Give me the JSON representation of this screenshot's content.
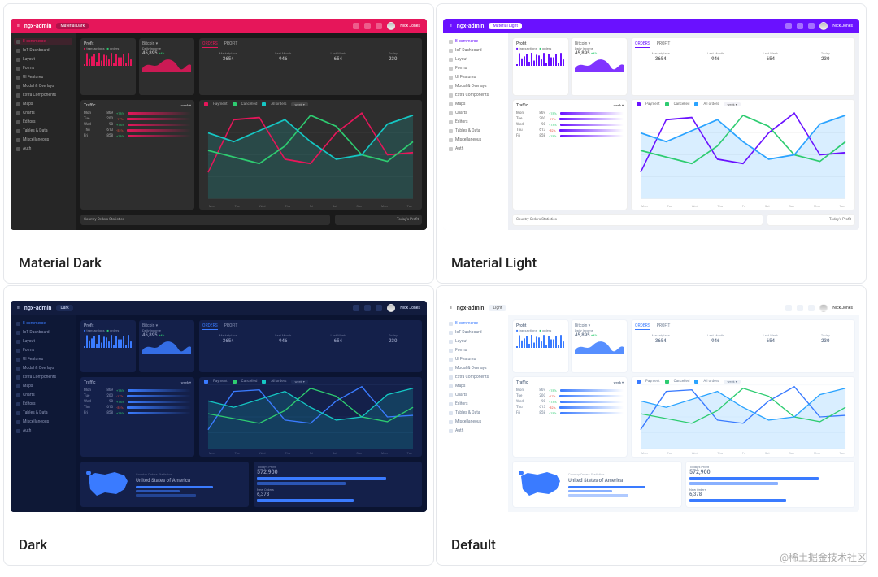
{
  "watermark": "@稀土掘金技术社区",
  "themes": [
    {
      "id": "material-dark",
      "cls": "t-md",
      "caption": "Material Dark",
      "pill": "Material Dark",
      "hasBottom": false,
      "accent": "#e6165a",
      "accent2": "#2ecc71",
      "accent3": "#15c7c4",
      "grid": "#3a3a3a"
    },
    {
      "id": "material-light",
      "cls": "t-ml",
      "caption": "Material Light",
      "pill": "Material Light",
      "hasBottom": false,
      "accent": "#6a11ff",
      "accent2": "#2ecc71",
      "accent3": "#2aa3ff",
      "grid": "#eeeeee"
    },
    {
      "id": "dark",
      "cls": "t-dk",
      "caption": "Dark",
      "pill": "Dark",
      "hasBottom": true,
      "accent": "#3a7bff",
      "accent2": "#2ecc71",
      "accent3": "#15c7c4",
      "grid": "#243464"
    },
    {
      "id": "default",
      "cls": "t-df",
      "caption": "Default",
      "pill": "Light",
      "hasBottom": true,
      "accent": "#3a7bff",
      "accent2": "#2ecc71",
      "accent3": "#2aa3ff",
      "grid": "#eef2f8"
    }
  ],
  "common": {
    "brand": "ngx-admin",
    "user": "Nick Jones",
    "sidebar": [
      "E-commerce",
      "IoT Dashboard",
      "Layout",
      "Forms",
      "UI Features",
      "Modal & Overlays",
      "Extra Components",
      "Maps",
      "Charts",
      "Editors",
      "Tables & Data",
      "Miscellaneous",
      "Auth"
    ],
    "profit": {
      "title": "Profit",
      "legend": [
        "transactions",
        "orders"
      ],
      "dailyIncomeLabel": "Daily Income",
      "dailyIncome": "45,895",
      "delta": "+4%"
    },
    "bitcoin": "Bitcoin",
    "ordersTabs": [
      "ORDERS",
      "PROFIT"
    ],
    "ordersLegend": [
      "Payment",
      "Cancelled",
      "All orders"
    ],
    "weekLabel": "week",
    "stats": [
      {
        "label": "Marketplace",
        "value": "3654"
      },
      {
        "label": "Last Month",
        "value": "946"
      },
      {
        "label": "Last Week",
        "value": "654"
      },
      {
        "label": "Today",
        "value": "230"
      }
    ],
    "traffic": {
      "title": "Traffic",
      "rows": [
        {
          "day": "Mon",
          "n": "869",
          "chg": "+78%",
          "up": true
        },
        {
          "day": "Tue",
          "n": "200",
          "chg": "-17%",
          "up": false
        },
        {
          "day": "Wed",
          "n": "98",
          "chg": "+74%",
          "up": true
        },
        {
          "day": "Thu",
          "n": "613",
          "chg": "-52%",
          "up": false
        },
        {
          "day": "Fri",
          "n": "858",
          "chg": "+78%",
          "up": true
        }
      ]
    },
    "xaxis": [
      "Mon",
      "Tue",
      "Wed",
      "Thu",
      "Fri",
      "Sat",
      "Sun",
      "Mon",
      "Tue"
    ],
    "map": {
      "title": "Country Orders Statistics",
      "country": "United States of America"
    },
    "todaysProfitLabel": "Today's Profit",
    "todaysProfit": "572,900",
    "newOrdersLabel": "New Orders",
    "newOrders": "6,378"
  },
  "chart_data": {
    "type": "line",
    "categories": [
      "Mon",
      "Tue",
      "Wed",
      "Thu",
      "Fri",
      "Sat",
      "Sun",
      "Mon",
      "Tue"
    ],
    "series": [
      {
        "name": "Payment",
        "values": [
          120,
          360,
          370,
          180,
          160,
          300,
          390,
          200,
          210
        ]
      },
      {
        "name": "Cancelled",
        "values": [
          220,
          190,
          160,
          240,
          380,
          330,
          200,
          170,
          260
        ]
      },
      {
        "name": "All orders",
        "values": [
          300,
          260,
          310,
          360,
          260,
          180,
          200,
          340,
          380
        ]
      }
    ],
    "ylim": [
      0,
      400
    ]
  }
}
